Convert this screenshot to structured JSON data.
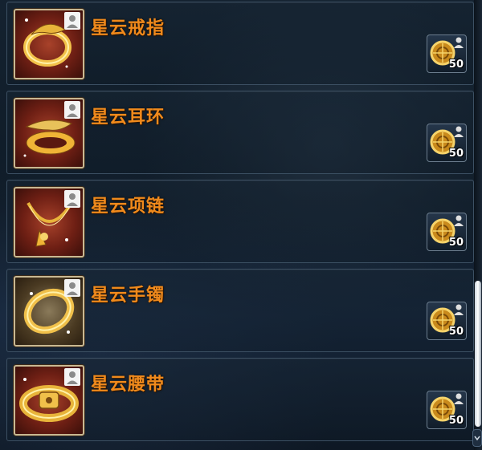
{
  "items": [
    {
      "name": "星云戒指",
      "icon": "ring-icon",
      "cost_icon": "gold-token-icon",
      "cost_qty": "50"
    },
    {
      "name": "星云耳环",
      "icon": "earring-icon",
      "cost_icon": "gold-token-icon",
      "cost_qty": "50"
    },
    {
      "name": "星云项链",
      "icon": "necklace-icon",
      "cost_icon": "gold-token-icon",
      "cost_qty": "50"
    },
    {
      "name": "星云手镯",
      "icon": "bracelet-icon",
      "cost_icon": "gold-token-icon",
      "cost_qty": "50"
    },
    {
      "name": "星云腰带",
      "icon": "belt-icon",
      "cost_icon": "gold-token-icon",
      "cost_qty": "50"
    }
  ],
  "colors": {
    "item_name": "#f08a1c",
    "row_border": "#3c5063",
    "icon_frame": "#c8b892"
  }
}
